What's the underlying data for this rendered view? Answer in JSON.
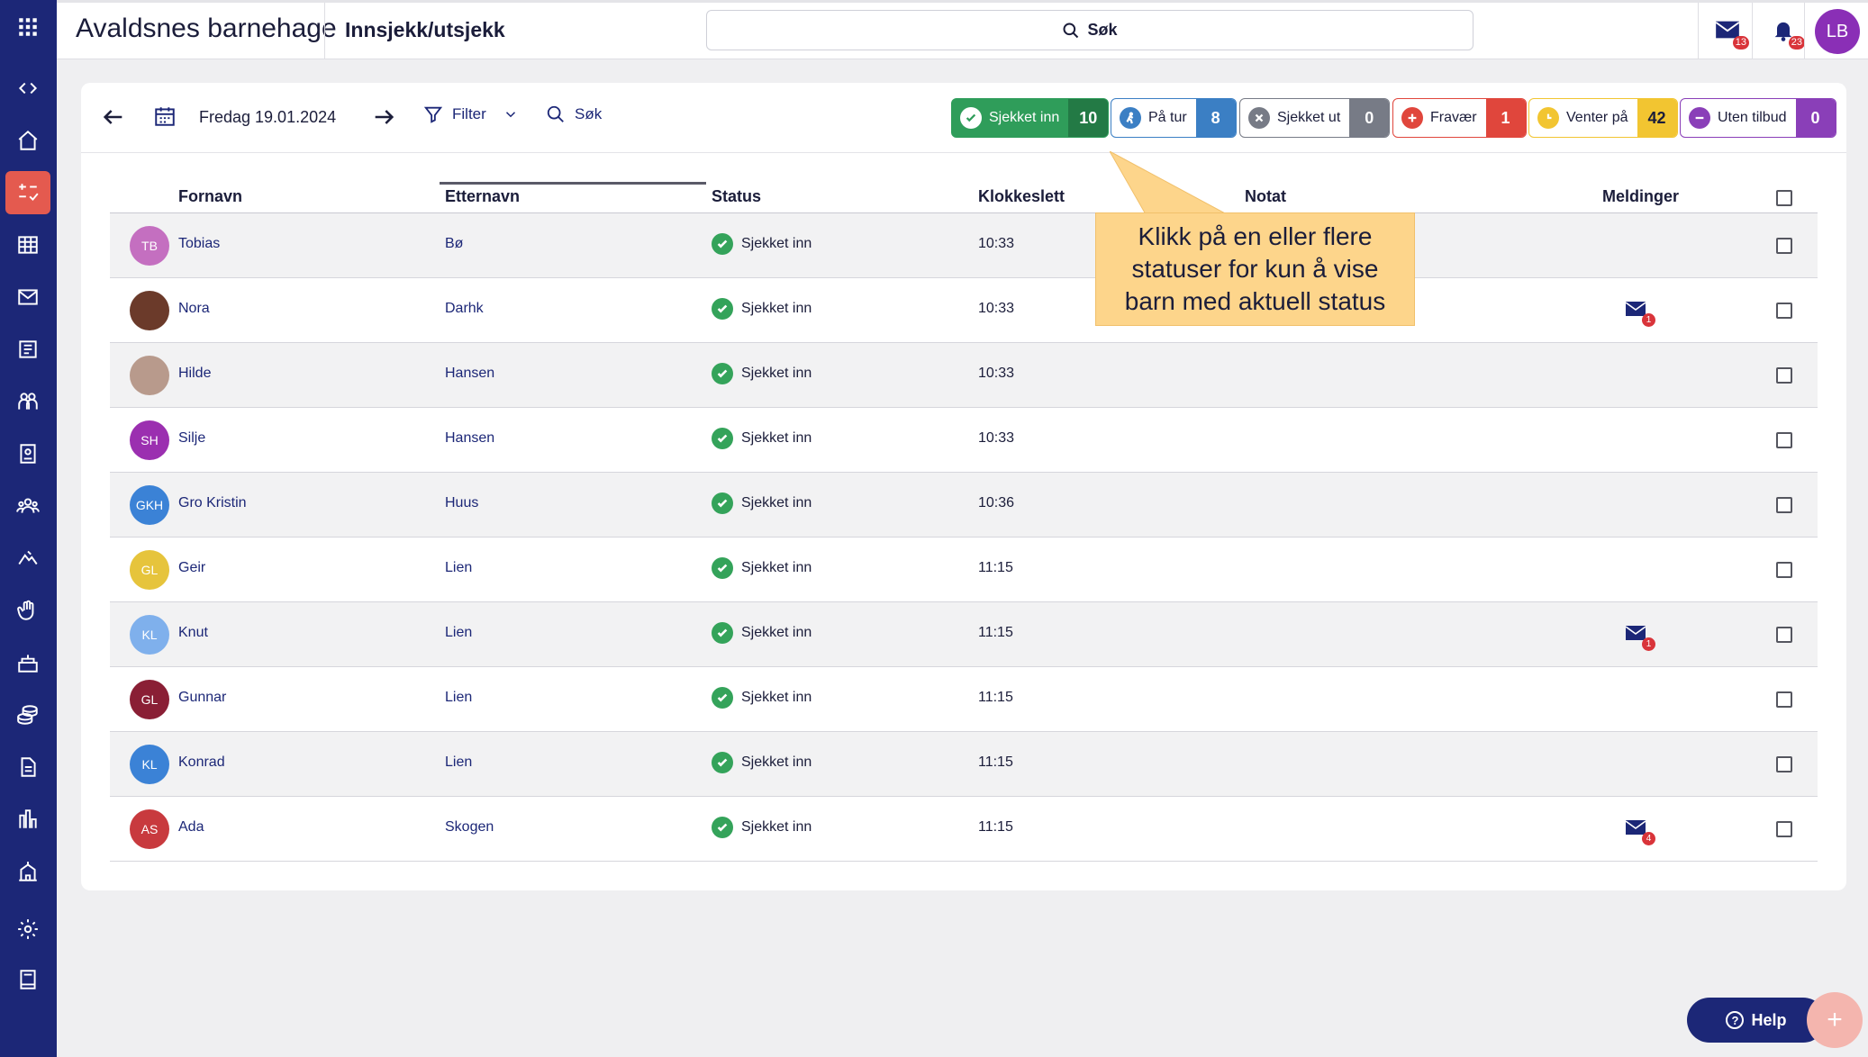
{
  "app": {
    "org_name": "Avaldsnes barnehage",
    "page_title": "Innsjekk/utsjekk",
    "search_label": "Søk",
    "mail_count": "13",
    "notif_count": "23",
    "user_initials": "LB"
  },
  "nav": [
    "apps-grid-icon",
    "code-icon",
    "home-icon",
    "checkin-icon",
    "calendar-grid-icon",
    "mail-icon",
    "news-icon",
    "children-icon",
    "badge-icon",
    "groups-icon",
    "trip-icon",
    "hand-icon",
    "cake-icon",
    "coins-icon",
    "document-icon",
    "chart-icon",
    "school-icon",
    "settings-icon",
    "book-icon"
  ],
  "toolbar": {
    "date": "Fredag 19.01.2024",
    "filter_label": "Filter",
    "search_label": "Søk"
  },
  "chips": [
    {
      "label": "Sjekket inn",
      "count": "10",
      "color": "#2f9d5a",
      "dark": "#237a45"
    },
    {
      "label": "På tur",
      "count": "8",
      "color": "#3b7fc4",
      "dark": "#3b7fc4"
    },
    {
      "label": "Sjekket ut",
      "count": "0",
      "color": "#777b86",
      "dark": "#777b86"
    },
    {
      "label": "Fravær",
      "count": "1",
      "color": "#e0463c",
      "dark": "#e0463c"
    },
    {
      "label": "Venter på",
      "count": "42",
      "color": "#f2c531",
      "dark": "#f2c531"
    },
    {
      "label": "Uten tilbud",
      "count": "0",
      "color": "#8a3fb8",
      "dark": "#8a3fb8"
    }
  ],
  "table": {
    "headers": {
      "first": "Fornavn",
      "last": "Etternavn",
      "status": "Status",
      "time": "Klokkeslett",
      "note": "Notat",
      "messages": "Meldinger"
    },
    "rows": [
      {
        "initials": "TB",
        "first": "Tobias",
        "last": "Bø",
        "status": "Sjekket inn",
        "time": "10:33",
        "avatar_color": "#c46fc0",
        "messages": ""
      },
      {
        "initials": "",
        "first": "Nora",
        "last": "Darhk",
        "status": "Sjekket inn",
        "time": "10:33",
        "avatar_color": "#6b3a2a",
        "messages": "1"
      },
      {
        "initials": "",
        "first": "Hilde",
        "last": "Hansen",
        "status": "Sjekket inn",
        "time": "10:33",
        "avatar_color": "#b89a8c",
        "messages": ""
      },
      {
        "initials": "SH",
        "first": "Silje",
        "last": "Hansen",
        "status": "Sjekket inn",
        "time": "10:33",
        "avatar_color": "#9b2fb0",
        "messages": ""
      },
      {
        "initials": "GKH",
        "first": "Gro Kristin",
        "last": "Huus",
        "status": "Sjekket inn",
        "time": "10:36",
        "avatar_color": "#3b82d6",
        "messages": ""
      },
      {
        "initials": "GL",
        "first": "Geir",
        "last": "Lien",
        "status": "Sjekket inn",
        "time": "11:15",
        "avatar_color": "#e6c43c",
        "messages": ""
      },
      {
        "initials": "KL",
        "first": "Knut",
        "last": "Lien",
        "status": "Sjekket inn",
        "time": "11:15",
        "avatar_color": "#7fb0ec",
        "messages": "1"
      },
      {
        "initials": "GL",
        "first": "Gunnar",
        "last": "Lien",
        "status": "Sjekket inn",
        "time": "11:15",
        "avatar_color": "#8a1f35",
        "messages": ""
      },
      {
        "initials": "KL",
        "first": "Konrad",
        "last": "Lien",
        "status": "Sjekket inn",
        "time": "11:15",
        "avatar_color": "#3b82d6",
        "messages": ""
      },
      {
        "initials": "AS",
        "first": "Ada",
        "last": "Skogen",
        "status": "Sjekket inn",
        "time": "11:15",
        "avatar_color": "#c83a3e",
        "messages": "4"
      }
    ]
  },
  "tooltip": {
    "text": "Klikk på en eller flere statuser for kun å vise barn med aktuell status"
  },
  "help": {
    "label": "Help"
  },
  "fab": {
    "label": "+"
  }
}
